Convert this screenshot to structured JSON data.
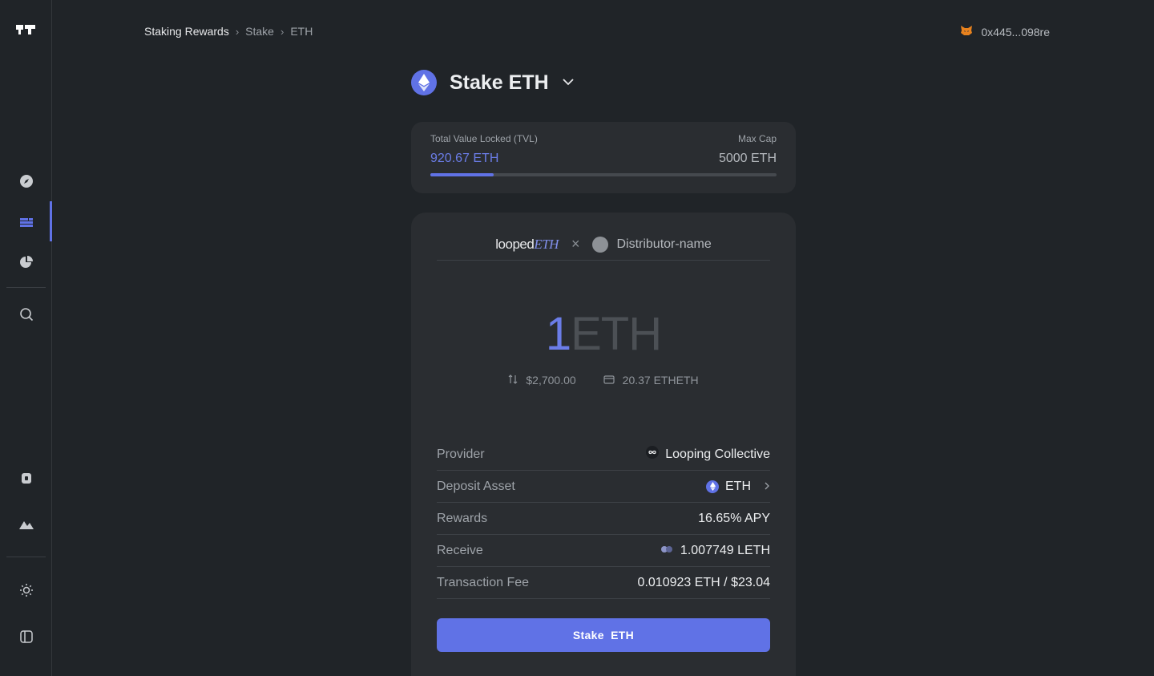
{
  "breadcrumb": {
    "items": [
      "Staking Rewards",
      "Stake",
      "ETH"
    ],
    "separator": "›"
  },
  "wallet": {
    "address": "0x445...098re",
    "icon": "metamask-fox-icon"
  },
  "sidebar": {
    "items": [
      {
        "name": "explore",
        "icon": "compass-icon"
      },
      {
        "name": "staking",
        "icon": "layers-icon",
        "active": true
      },
      {
        "name": "portfolio",
        "icon": "pie-chart-icon"
      },
      {
        "name": "search",
        "icon": "search-icon"
      },
      {
        "name": "wallet",
        "icon": "wallet-icon"
      },
      {
        "name": "landscape",
        "icon": "mountain-icon"
      },
      {
        "name": "theme",
        "icon": "sun-icon"
      },
      {
        "name": "collapse",
        "icon": "sidebar-toggle-icon"
      }
    ],
    "accent": "#6072e6"
  },
  "title": {
    "text": "Stake ETH",
    "icon": "ethereum-icon"
  },
  "tvl": {
    "label": "Total Value Locked (TVL)",
    "value": "920.67 ETH",
    "max_label": "Max Cap",
    "max_value": "5000 ETH",
    "progress_fraction": 0.184
  },
  "partner": {
    "brand_prefix": "looped",
    "brand_suffix": "ETH",
    "separator": "×",
    "distributor": "Distributor-name"
  },
  "amount": {
    "value": "1",
    "unit": "ETH",
    "usd": "$2,700.00",
    "balance": "20.37 ETHETH"
  },
  "details": {
    "provider_label": "Provider",
    "provider_value": "Looping Collective",
    "deposit_label": "Deposit Asset",
    "deposit_value": "ETH",
    "rewards_label": "Rewards",
    "rewards_value": "16.65% APY",
    "receive_label": "Receive",
    "receive_value": "1.007749 LETH",
    "fee_label": "Transaction Fee",
    "fee_value": "0.010923 ETH / $23.04"
  },
  "action": {
    "stake_label": "Stake  ETH"
  }
}
